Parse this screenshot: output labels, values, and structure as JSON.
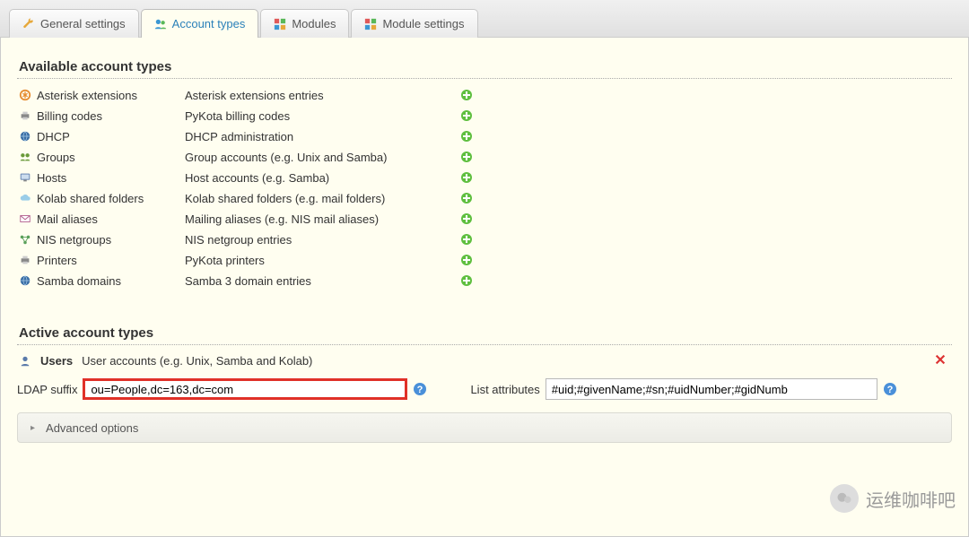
{
  "tabs": [
    {
      "label": "General settings",
      "icon": "wrench-icon"
    },
    {
      "label": "Account types",
      "icon": "users-icon"
    },
    {
      "label": "Modules",
      "icon": "blocks-icon"
    },
    {
      "label": "Module settings",
      "icon": "blocks-icon"
    }
  ],
  "active_tab_index": 1,
  "sections": {
    "available_title": "Available account types",
    "active_title": "Active account types"
  },
  "available_types": [
    {
      "name": "Asterisk extensions",
      "desc": "Asterisk extensions entries",
      "icon": "asterisk-icon"
    },
    {
      "name": "Billing codes",
      "desc": "PyKota billing codes",
      "icon": "printer-icon"
    },
    {
      "name": "DHCP",
      "desc": "DHCP administration",
      "icon": "globe-icon"
    },
    {
      "name": "Groups",
      "desc": "Group accounts (e.g. Unix and Samba)",
      "icon": "group-icon"
    },
    {
      "name": "Hosts",
      "desc": "Host accounts (e.g. Samba)",
      "icon": "host-icon"
    },
    {
      "name": "Kolab shared folders",
      "desc": "Kolab shared folders (e.g. mail folders)",
      "icon": "cloud-icon"
    },
    {
      "name": "Mail aliases",
      "desc": "Mailing aliases (e.g. NIS mail aliases)",
      "icon": "mail-icon"
    },
    {
      "name": "NIS netgroups",
      "desc": "NIS netgroup entries",
      "icon": "netgroup-icon"
    },
    {
      "name": "Printers",
      "desc": "PyKota printers",
      "icon": "printer-icon"
    },
    {
      "name": "Samba domains",
      "desc": "Samba 3 domain entries",
      "icon": "globe-icon"
    }
  ],
  "active_types": [
    {
      "name": "Users",
      "desc": "User accounts (e.g. Unix, Samba and Kolab)",
      "icon": "user-icon"
    }
  ],
  "form": {
    "ldap_label": "LDAP suffix",
    "ldap_value": "ou=People,dc=163,dc=com",
    "list_label": "List attributes",
    "list_value": "#uid;#givenName;#sn;#uidNumber;#gidNumb"
  },
  "advanced_label": "Advanced options",
  "watermark_text": "运维咖啡吧"
}
